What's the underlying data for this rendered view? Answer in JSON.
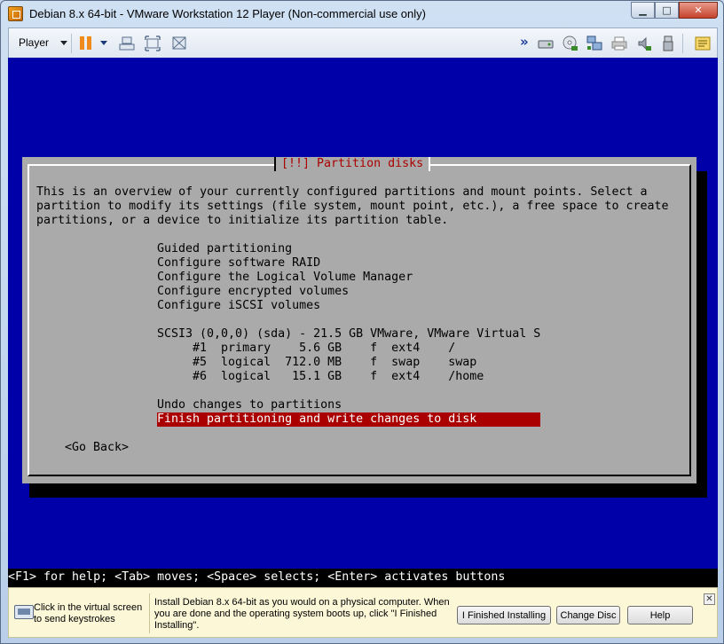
{
  "window": {
    "title": "Debian 8.x 64-bit - VMware Workstation 12 Player (Non-commercial use only)",
    "close_glyph": "✕",
    "max_glyph": "□",
    "min_glyph": "▁"
  },
  "toolbar": {
    "player_label": "Player",
    "more_glyph": "»"
  },
  "installer": {
    "dialog_title": "[!!] Partition disks",
    "intro_lines": [
      "This is an overview of your currently configured partitions and mount points. Select a",
      "partition to modify its settings (file system, mount point, etc.), a free space to create",
      "partitions, or a device to initialize its partition table."
    ],
    "menu": [
      "Guided partitioning",
      "Configure software RAID",
      "Configure the Logical Volume Manager",
      "Configure encrypted volumes",
      "Configure iSCSI volumes"
    ],
    "disk_line": "SCSI3 (0,0,0) (sda) - 21.5 GB VMware, VMware Virtual S",
    "partitions": [
      "     #1  primary    5.6 GB    f  ext4    /",
      "     #5  logical  712.0 MB    f  swap    swap",
      "     #6  logical   15.1 GB    f  ext4    /home"
    ],
    "undo": "Undo changes to partitions",
    "finish": "Finish partitioning and write changes to disk",
    "go_back": "<Go Back>",
    "help_line": "<F1> for help; <Tab> moves; <Space> selects; <Enter> activates buttons"
  },
  "hint_bar": {
    "click_hint": "Click in the virtual screen to send keystrokes",
    "install_text": "Install Debian 8.x 64-bit as you would on a physical computer. When you are done and the operating system boots up, click \"I Finished Installing\".",
    "finished_button": "I Finished Installing",
    "change_disc_button": "Change Disc",
    "help_button": "Help",
    "close_glyph": "✕"
  },
  "colors": {
    "vm_background": "#0000a8",
    "dialog": "#aaaaaa",
    "selection": "#aa0000"
  },
  "icons": [
    "app-icon",
    "pause-icon",
    "send-ctrl-alt-del-icon",
    "full-screen-icon",
    "unity-icon",
    "hard-disk-icon",
    "cd-dvd-icon",
    "network-adapter-icon",
    "printer-icon",
    "sound-card-icon",
    "usb-icon",
    "message-log-icon"
  ]
}
